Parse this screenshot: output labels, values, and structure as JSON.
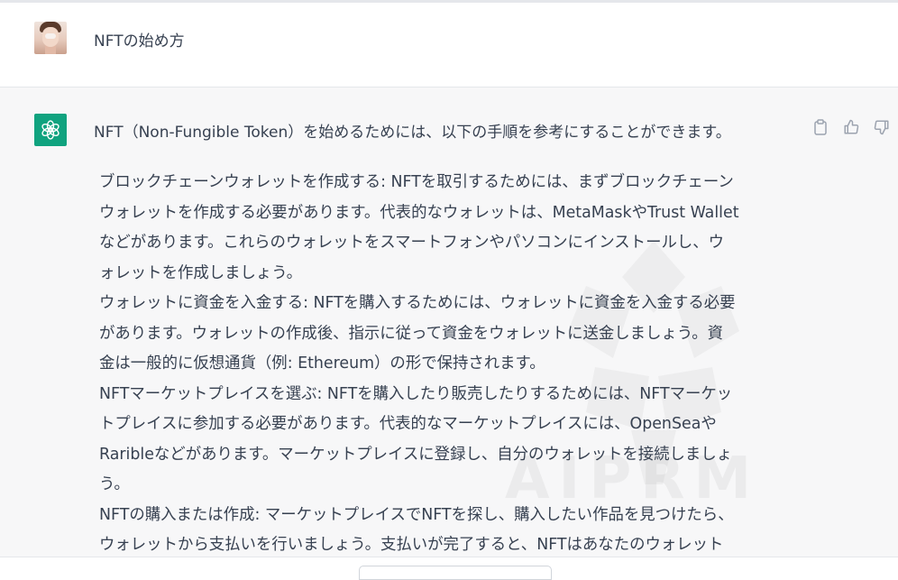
{
  "user": {
    "message": "NFTの始め方"
  },
  "assistant": {
    "intro": "NFT（Non-Fungible Token）を始めるためには、以下の手順を参考にすることができます。",
    "lines": [
      "ブロックチェーンウォレットを作成する: NFTを取引するためには、まずブロックチェーン",
      "ウォレットを作成する必要があります。代表的なウォレットは、MetaMaskやTrust Wallet",
      "などがあります。これらのウォレットをスマートフォンやパソコンにインストールし、ウ",
      "ォレットを作成しましょう。",
      "ウォレットに資金を入金する: NFTを購入するためには、ウォレットに資金を入金する必要",
      "があります。ウォレットの作成後、指示に従って資金をウォレットに送金しましょう。資",
      "金は一般的に仮想通貨（例: Ethereum）の形で保持されます。",
      "NFTマーケットプレイスを選ぶ: NFTを購入したり販売したりするためには、NFTマーケッ",
      "トプレイスに参加する必要があります。代表的なマーケットプレイスには、OpenSeaや",
      "Raribleなどがあります。マーケットプレイスに登録し、自分のウォレットを接続しましょ",
      "う。",
      "NFTの購入または作成: マーケットプレイスでNFTを探し、購入したい作品を見つけたら、",
      "ウォレットから支払いを行いましょう。支払いが完了すると、NFTはあなたのウォレット"
    ]
  },
  "watermark": {
    "text": "AIPRM"
  },
  "icons": {
    "copy": "clipboard-icon",
    "like": "thumbs-up-icon",
    "dislike": "thumbs-down-icon",
    "assistant_logo": "openai-logo-icon"
  },
  "colors": {
    "assistant_bg": "#f7f7f8",
    "logo_bg": "#10a37f",
    "text": "#374151"
  }
}
